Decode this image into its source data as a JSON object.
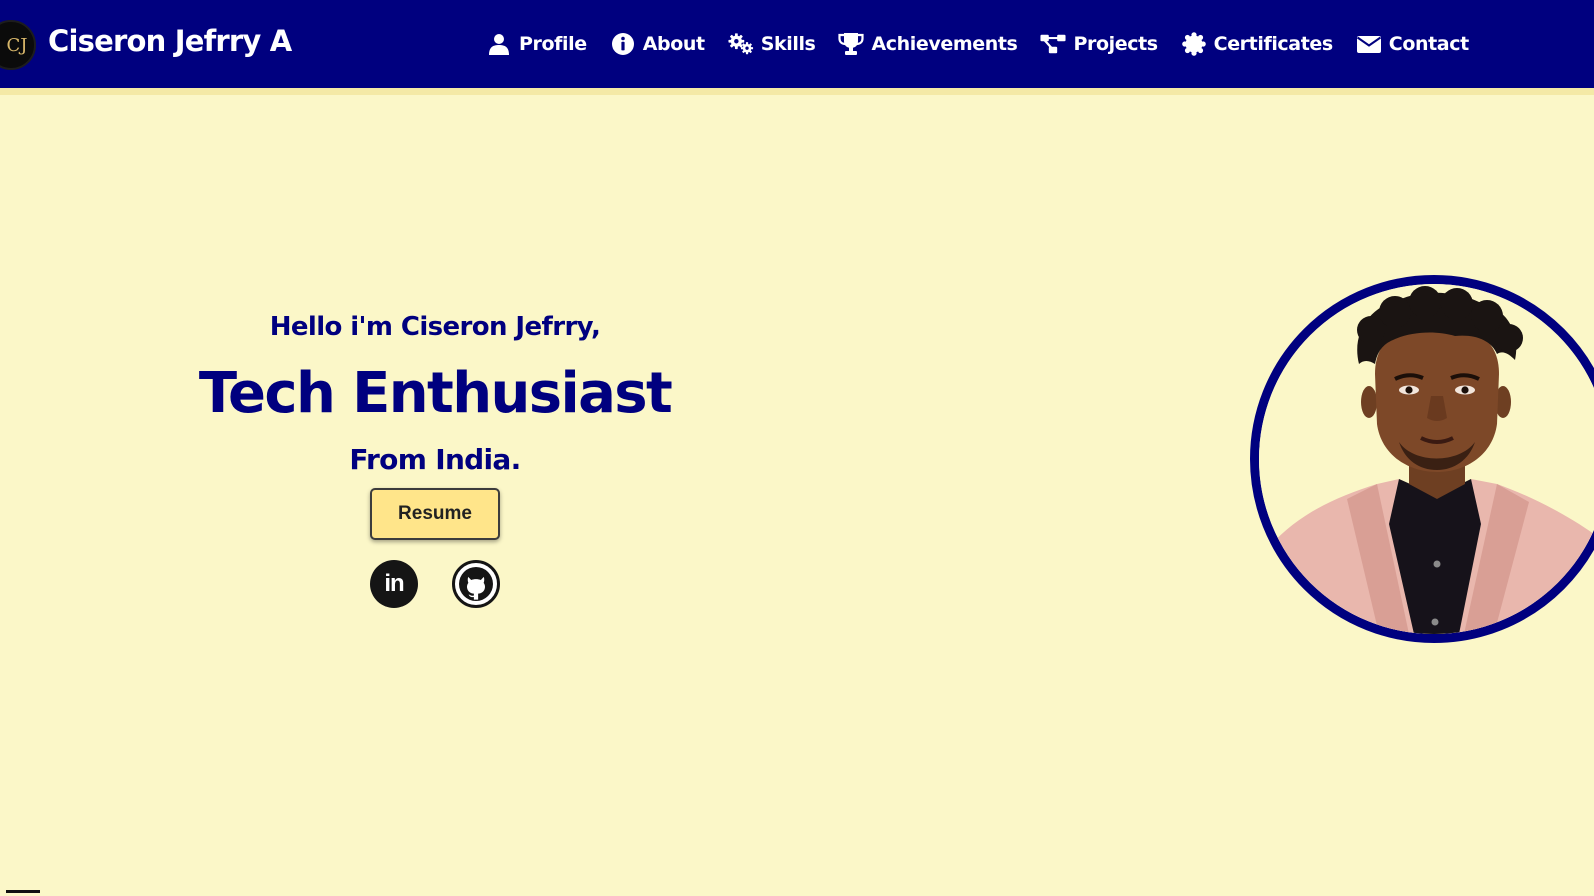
{
  "header": {
    "logo_text": "CJ",
    "brand_name": "Ciseron Jefrry A",
    "nav": [
      {
        "label": "Profile",
        "icon": "user-icon"
      },
      {
        "label": "About",
        "icon": "info-circle-icon"
      },
      {
        "label": "Skills",
        "icon": "gears-icon"
      },
      {
        "label": "Achievements",
        "icon": "trophy-icon"
      },
      {
        "label": "Projects",
        "icon": "diagram-project-icon"
      },
      {
        "label": "Certificates",
        "icon": "certificate-icon"
      },
      {
        "label": "Contact",
        "icon": "envelope-icon"
      }
    ]
  },
  "hero": {
    "greeting": "Hello i'm Ciseron Jefrry,",
    "headline": "Tech Enthusiast",
    "origin": "From India.",
    "resume_label": "Resume",
    "socials": [
      {
        "icon": "linkedin-icon",
        "label": "in"
      },
      {
        "icon": "github-icon"
      }
    ]
  },
  "colors": {
    "navy": "#00007f",
    "cream": "#fbf7c8",
    "resume_button": "#ffe58a",
    "nav_underline": "#f4e9a6"
  }
}
